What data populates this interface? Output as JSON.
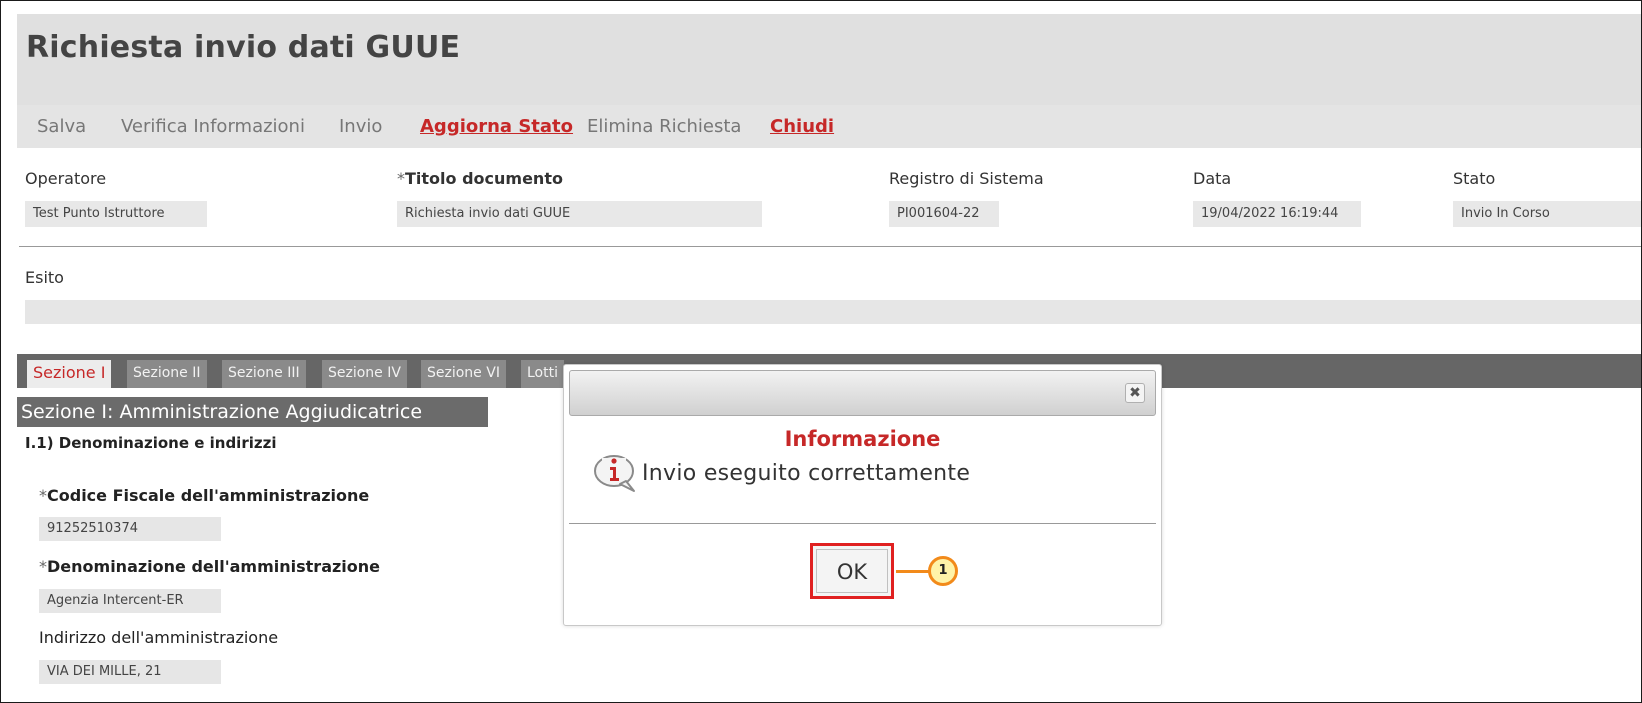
{
  "page_title": "Richiesta invio dati GUUE",
  "toolbar": {
    "items": [
      {
        "label": "Salva"
      },
      {
        "label": "Verifica Informazioni"
      },
      {
        "label": "Invio"
      },
      {
        "label": "Aggiorna Stato"
      },
      {
        "label": "Elimina Richiesta"
      },
      {
        "label": "Chiudi"
      }
    ]
  },
  "fields": {
    "operatore": {
      "label": "Operatore",
      "value": "Test Punto Istruttore"
    },
    "titolo": {
      "required_mark": "*",
      "label": "Titolo documento",
      "value": "Richiesta invio dati GUUE"
    },
    "registro": {
      "label": "Registro di Sistema",
      "value": "PI001604-22"
    },
    "data": {
      "label": "Data",
      "value": "19/04/2022 16:19:44"
    },
    "stato": {
      "label": "Stato",
      "value": "Invio In Corso"
    }
  },
  "esito": {
    "label": "Esito",
    "value": ""
  },
  "tabs": [
    {
      "label": "Sezione I"
    },
    {
      "label": "Sezione II"
    },
    {
      "label": "Sezione III"
    },
    {
      "label": "Sezione IV"
    },
    {
      "label": "Sezione VI"
    },
    {
      "label": "Lotti"
    }
  ],
  "section": {
    "title": "Sezione I: Amministrazione Aggiudicatrice",
    "subtitle": "I.1) Denominazione e indirizzi",
    "codice_fiscale": {
      "required_mark": "*",
      "label": "Codice Fiscale dell'amministrazione",
      "value": "91252510374"
    },
    "denominazione": {
      "required_mark": "*",
      "label": "Denominazione dell'amministrazione",
      "value": "Agenzia Intercent-ER"
    },
    "indirizzo": {
      "label": "Indirizzo dell'amministrazione",
      "value": "VIA DEI MILLE, 21"
    }
  },
  "modal": {
    "title": "Informazione",
    "message": "Invio eseguito correttamente",
    "ok_label": "OK",
    "close_glyph": "✖"
  },
  "callout": {
    "number": "1"
  },
  "colors": {
    "accent_red": "#c62828",
    "callout_orange": "#f28a1a",
    "callout_fill": "#fff3a8",
    "highlight_red": "#e02020"
  },
  "icons": {
    "info": "info-icon",
    "close": "close-icon"
  }
}
